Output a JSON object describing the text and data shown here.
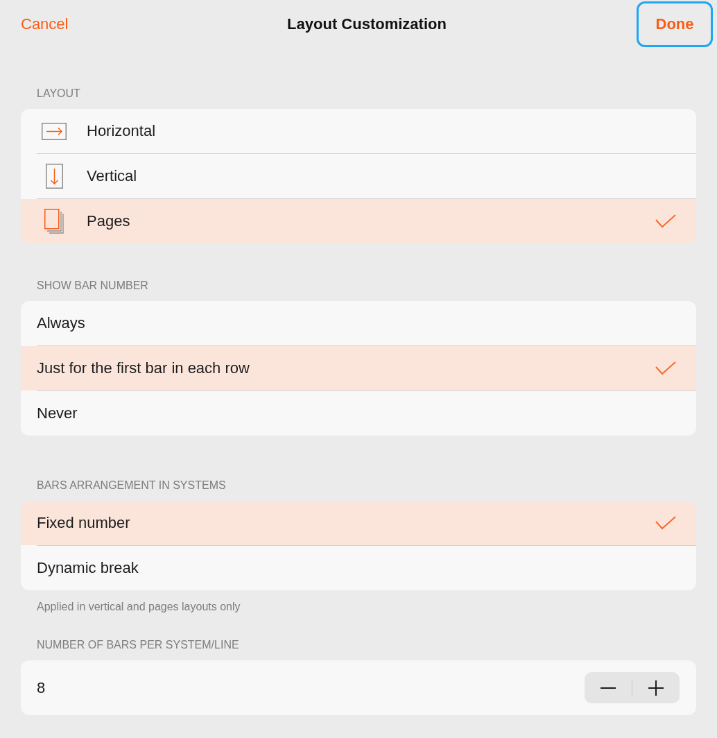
{
  "nav": {
    "cancel": "Cancel",
    "title": "Layout Customization",
    "done": {
      "label": "Done",
      "focused": true
    }
  },
  "sections": [
    {
      "kind": "choice",
      "header": "LAYOUT",
      "options": [
        {
          "kind": "horizontal",
          "label": "Horizontal",
          "selected": false
        },
        {
          "kind": "vertical",
          "label": "Vertical",
          "selected": false
        },
        {
          "kind": "pages",
          "label": "Pages",
          "selected": true
        }
      ]
    },
    {
      "kind": "choice",
      "header": "SHOW BAR NUMBER",
      "options": [
        {
          "kind": "text",
          "label": "Always",
          "selected": false
        },
        {
          "kind": "text",
          "label": "Just for the first bar in each row",
          "selected": true
        },
        {
          "kind": "text",
          "label": "Never",
          "selected": false
        }
      ]
    },
    {
      "kind": "choice",
      "header": "BARS ARRANGEMENT IN SYSTEMS",
      "options": [
        {
          "kind": "text",
          "label": "Fixed number",
          "selected": true
        },
        {
          "kind": "text",
          "label": "Dynamic break",
          "selected": false
        }
      ],
      "footer": "Applied in vertical and pages layouts only"
    },
    {
      "kind": "stepper",
      "header": "NUMBER OF BARS PER SYSTEM/LINE",
      "value": "8"
    }
  ]
}
